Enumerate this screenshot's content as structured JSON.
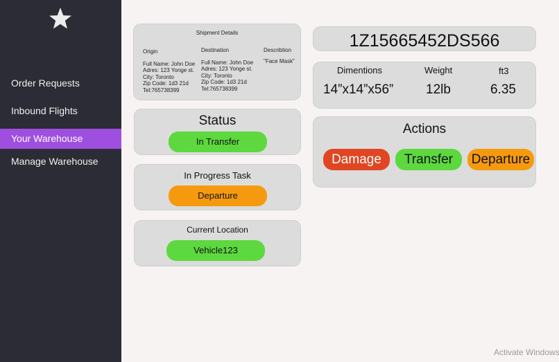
{
  "sidebar": {
    "items": [
      {
        "label": "Order Requests"
      },
      {
        "label": "Inbound Flights"
      },
      {
        "label": "Your Warehouse"
      },
      {
        "label": "Manage Warehouse"
      }
    ]
  },
  "shipment": {
    "title": "Shipment Details",
    "origin_header": "Origin",
    "destination_header": "Destination",
    "description_header": "Describtion",
    "origin": [
      "Full Name: John Doe",
      "Adres: 123 Yonge st.",
      "City: Toronto",
      "Zip Code: 1d3 21d",
      "Tel:765738399"
    ],
    "destination": [
      "Full Name: John Doe",
      "Adres: 123 Yonge st.",
      "City: Toronto",
      "Zip Code: 1d3 21d",
      "Tel:765738399"
    ],
    "description": "\"Face Mask\""
  },
  "status": {
    "title": "Status",
    "value": "In Transfer"
  },
  "task": {
    "title": "In Progress Task",
    "value": "Departure"
  },
  "location": {
    "title": "Current Location",
    "value": "Vehicle123"
  },
  "tracking": {
    "number": "1Z15665452DS566"
  },
  "dimensions": {
    "headers": [
      "Dimentions",
      "Weight",
      "ft3"
    ],
    "values": [
      "14”x14”x56”",
      "12lb",
      "6.35"
    ]
  },
  "actions": {
    "title": "Actions",
    "damage": "Damage",
    "transfer": "Transfer",
    "departure": "Departure"
  },
  "watermark": "Activate Windows",
  "colors": {
    "sidebar": "#2b2c35",
    "active": "#9f4fe0",
    "green": "#5dd83f",
    "orange": "#f59a0f",
    "red": "#e04622",
    "card": "#dcdcdc",
    "background": "#f7f3f3"
  }
}
